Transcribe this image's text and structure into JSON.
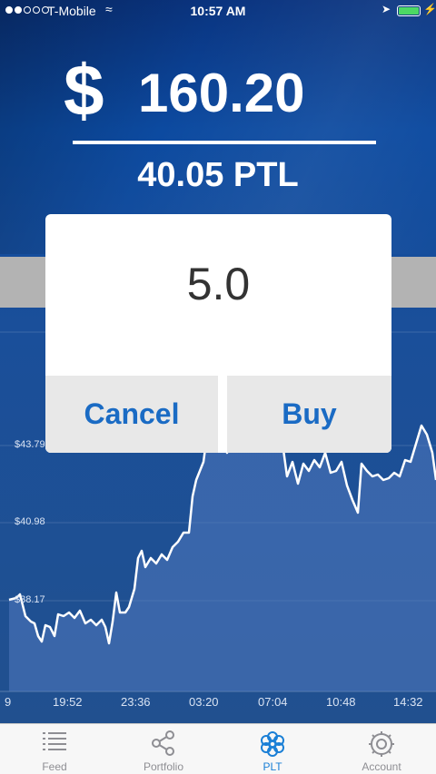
{
  "status_bar": {
    "carrier": "T-Mobile",
    "time": "10:57 AM"
  },
  "balance": {
    "currency_symbol": "$",
    "amount": "160.20",
    "token_amount": "40.05 PTL"
  },
  "dialog": {
    "value": "5.0",
    "cancel_label": "Cancel",
    "buy_label": "Buy"
  },
  "chart": {
    "y_labels": [
      "$43.79",
      "$40.98",
      "$38.17"
    ],
    "x_labels": [
      "9",
      "19:52",
      "23:36",
      "03:20",
      "07:04",
      "10:48",
      "14:32"
    ]
  },
  "tabs": [
    {
      "label": "Feed",
      "icon": "list-icon"
    },
    {
      "label": "Portfolio",
      "icon": "share-icon"
    },
    {
      "label": "PLT",
      "icon": "flower-icon"
    },
    {
      "label": "Account",
      "icon": "gear-icon"
    }
  ],
  "colors": {
    "accent": "#1a6bc4",
    "tab_active": "#1a7fd6",
    "background": "#0d3a8a",
    "battery": "#4cd964"
  }
}
